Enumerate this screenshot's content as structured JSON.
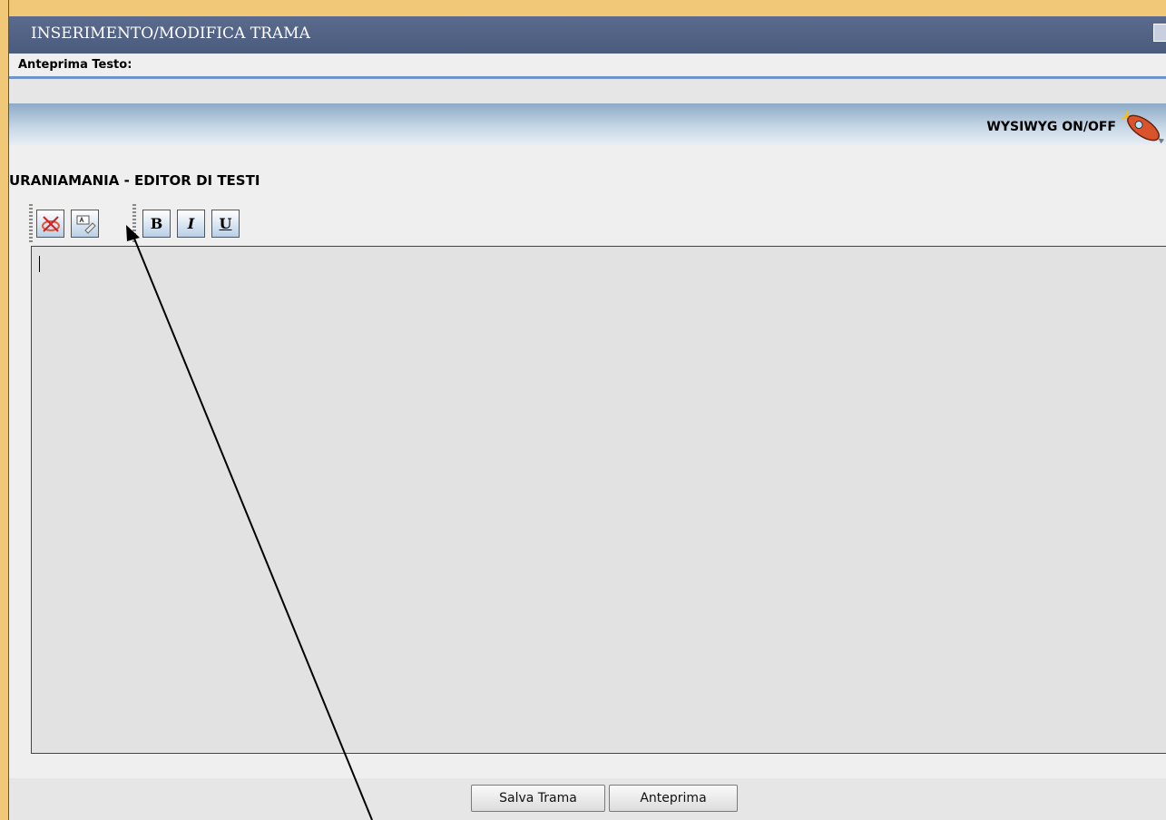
{
  "window": {
    "title": "INSERIMENTO/MODIFICA TRAMA",
    "preview_label": "Anteprima Testo:"
  },
  "wysiwyg": {
    "label": "WYSIWYG ON/OFF",
    "icon": "rocket-icon"
  },
  "editor": {
    "title": "URANIAMANIA - EDITOR DI TESTI",
    "content": "",
    "toolbar": [
      {
        "name": "remove-format-icon"
      },
      {
        "name": "spellcheck-icon"
      },
      {
        "name": "bold-button",
        "label": "B"
      },
      {
        "name": "italic-button",
        "label": "I"
      },
      {
        "name": "underline-button",
        "label": "U"
      }
    ]
  },
  "buttons": {
    "save": "Salva Trama",
    "preview": "Anteprima"
  },
  "colors": {
    "titlebar": "#4b5b7e",
    "accent_line": "#6f95c8",
    "editor_bg": "#e2e2e2"
  }
}
